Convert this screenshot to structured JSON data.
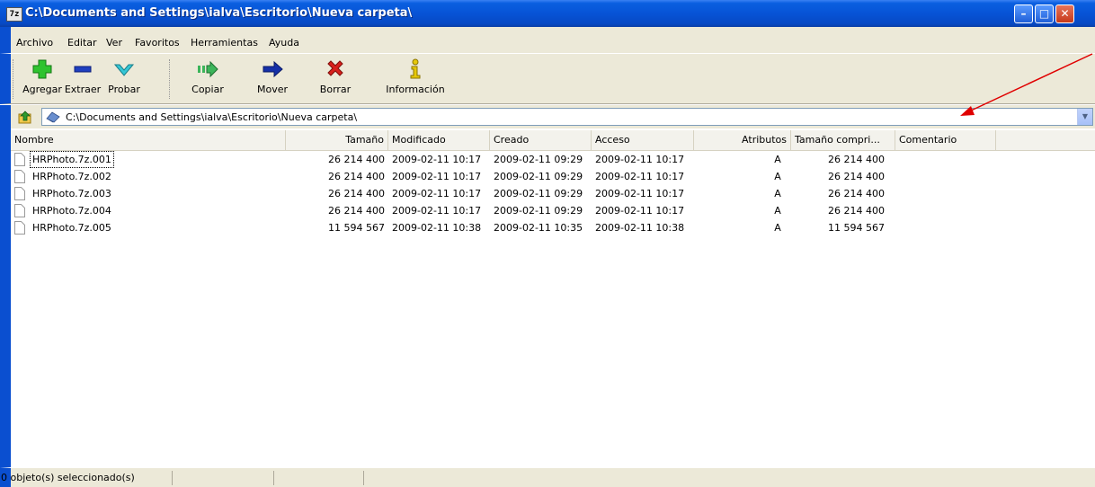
{
  "window": {
    "title": "C:\\Documents and Settings\\ialva\\Escritorio\\Nueva carpeta\\",
    "app_icon_text": "7z",
    "minimize_symbol": "–",
    "maximize_symbol": "□",
    "close_symbol": "✕"
  },
  "menu": {
    "items": [
      {
        "label": "Archivo"
      },
      {
        "label": "Editar"
      },
      {
        "label": "Ver"
      },
      {
        "label": "Favoritos"
      },
      {
        "label": "Herramientas"
      },
      {
        "label": "Ayuda"
      }
    ]
  },
  "toolbar": {
    "add_label": "Agregar",
    "extract_label": "Extraer",
    "test_label": "Probar",
    "copy_label": "Copiar",
    "move_label": "Mover",
    "delete_label": "Borrar",
    "info_label": "Información"
  },
  "address": {
    "path": "C:\\Documents and Settings\\ialva\\Escritorio\\Nueva carpeta\\",
    "dropdown_symbol": "▼"
  },
  "list": {
    "columns": {
      "name": "Nombre",
      "size": "Tamaño",
      "modified": "Modificado",
      "created": "Creado",
      "accessed": "Acceso",
      "attributes": "Atributos",
      "packed_size": "Tamaño compri...",
      "comment": "Comentario"
    },
    "rows": [
      {
        "name": "HRPhoto.7z.001",
        "size": "26 214 400",
        "modified": "2009-02-11 10:17",
        "created": "2009-02-11 09:29",
        "accessed": "2009-02-11 10:17",
        "attributes": "A",
        "packed_size": "26 214 400"
      },
      {
        "name": "HRPhoto.7z.002",
        "size": "26 214 400",
        "modified": "2009-02-11 10:17",
        "created": "2009-02-11 09:29",
        "accessed": "2009-02-11 10:17",
        "attributes": "A",
        "packed_size": "26 214 400"
      },
      {
        "name": "HRPhoto.7z.003",
        "size": "26 214 400",
        "modified": "2009-02-11 10:17",
        "created": "2009-02-11 09:29",
        "accessed": "2009-02-11 10:17",
        "attributes": "A",
        "packed_size": "26 214 400"
      },
      {
        "name": "HRPhoto.7z.004",
        "size": "26 214 400",
        "modified": "2009-02-11 10:17",
        "created": "2009-02-11 09:29",
        "accessed": "2009-02-11 10:17",
        "attributes": "A",
        "packed_size": "26 214 400"
      },
      {
        "name": "HRPhoto.7z.005",
        "size": "11 594 567",
        "modified": "2009-02-11 10:38",
        "created": "2009-02-11 10:35",
        "accessed": "2009-02-11 10:38",
        "attributes": "A",
        "packed_size": "11 594 567"
      }
    ]
  },
  "status": {
    "selection_text": "0 objeto(s) seleccionado(s)"
  },
  "colors": {
    "titlebar": "#0753d6",
    "chrome": "#ece9d8",
    "annotation_arrow": "#e00000"
  }
}
